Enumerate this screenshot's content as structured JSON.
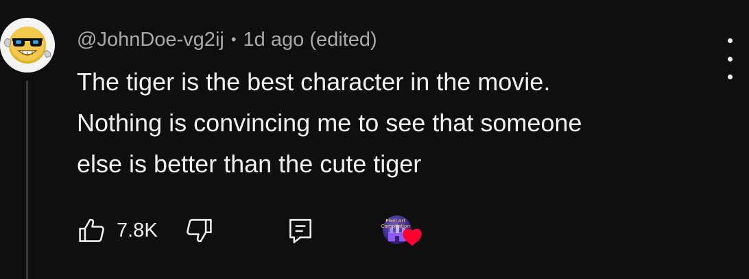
{
  "comment": {
    "author": "@JohnDoe-vg2ij",
    "separator": "•",
    "timestamp": "1d ago (edited)",
    "text_lines": [
      "The tiger is the best character in the movie.",
      "Nothing is convincing me to see that someone",
      "else is better than the cute tiger"
    ],
    "like_count": "7.8K",
    "creator_heart_label": "Pixel Art Compilation"
  },
  "icons": {
    "avatar": "sunglasses-emoji-avatar-icon",
    "more": "more-vertical-icon",
    "like": "thumbs-up-outline-icon",
    "dislike": "thumbs-down-outline-icon",
    "reply": "reply-comment-icon",
    "creator_heart": "red-heart-icon"
  },
  "colors": {
    "background": "#0f0f0f",
    "text_primary": "#f1f1f1",
    "text_secondary": "#aaaaaa",
    "heart": "#ff0033"
  }
}
